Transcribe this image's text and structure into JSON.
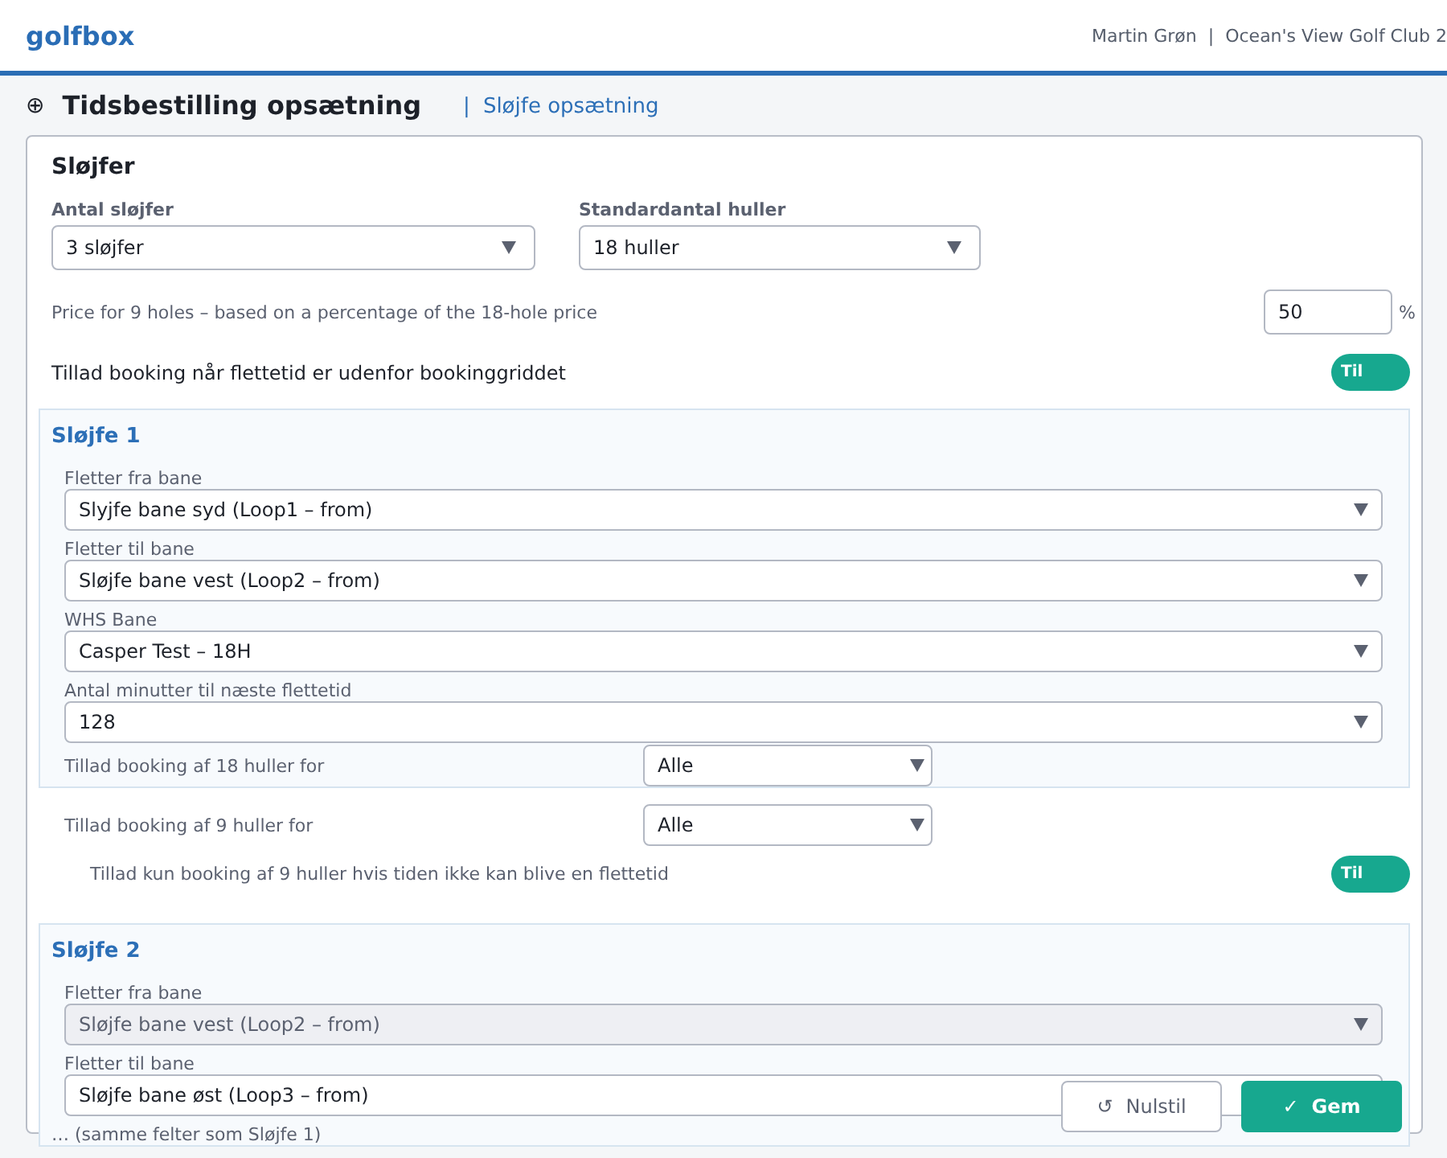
{
  "header": {
    "logo": "golfbox",
    "user": "Martin Grøn",
    "separator": "|",
    "club": "Ocean's View Golf Club 2"
  },
  "page": {
    "icon": "⊕",
    "title": "Tidsbestilling opsætning",
    "breadcrumb_separator": "|",
    "breadcrumb": "Sløjfe opsætning"
  },
  "card": {
    "title": "Sløjfer",
    "sections": [
      {
        "kind": "select-row",
        "items": [
          {
            "label": "Antal sløjfer",
            "value": "3 sløjfer"
          },
          {
            "label": "Standardantal huller",
            "value": "18 huller"
          }
        ]
      },
      {
        "kind": "percent",
        "label": "Price for 9 holes – based on a percentage of the 18-hole price",
        "value": "50",
        "unit": "%"
      },
      {
        "kind": "toggle",
        "label": "Tillad booking når flettetid er udenfor bookinggriddet",
        "on": true,
        "text": "Til"
      },
      {
        "kind": "loop",
        "title": "Sløjfe 1",
        "fields": [
          {
            "kind": "stacked",
            "label": "Fletter fra bane",
            "value": "Slyjfe bane syd (Loop1 – from)",
            "disabled": false
          },
          {
            "kind": "stacked",
            "label": "Fletter til bane",
            "value": "Sløjfe bane vest (Loop2 – from)",
            "disabled": false
          },
          {
            "kind": "stacked",
            "label": "WHS Bane",
            "value": "Casper Test – 18H",
            "disabled": false
          },
          {
            "kind": "stacked",
            "label": "Antal minutter til næste flettetid",
            "value": "128",
            "disabled": false
          },
          {
            "kind": "inline",
            "label": "Tillad booking af 18 huller for",
            "value": "Alle",
            "disabled": false
          }
        ]
      },
      {
        "kind": "inline",
        "label": "Tillad booking af 9 huller for",
        "value": "Alle"
      },
      {
        "kind": "sub-toggle",
        "label": "Tillad kun booking af 9 huller hvis tiden ikke kan blive en flettetid",
        "on": true,
        "text": "Til"
      },
      {
        "kind": "loop",
        "title": "Sløjfe 2",
        "fields": [
          {
            "kind": "stacked",
            "label": "Fletter fra bane",
            "value": "Sløjfe bane vest (Loop2 – from)",
            "disabled": true
          },
          {
            "kind": "stacked",
            "label": "Fletter til bane",
            "value": "Sløjfe bane øst (Loop3 – from)",
            "disabled": false,
            "caret": false
          }
        ],
        "note": "… (samme felter som Sløjfe 1)"
      }
    ]
  },
  "buttons": [
    {
      "kind": "secondary",
      "icon": "↺",
      "label": "Nulstil"
    },
    {
      "kind": "primary",
      "icon": "✓",
      "label": "Gem"
    }
  ]
}
